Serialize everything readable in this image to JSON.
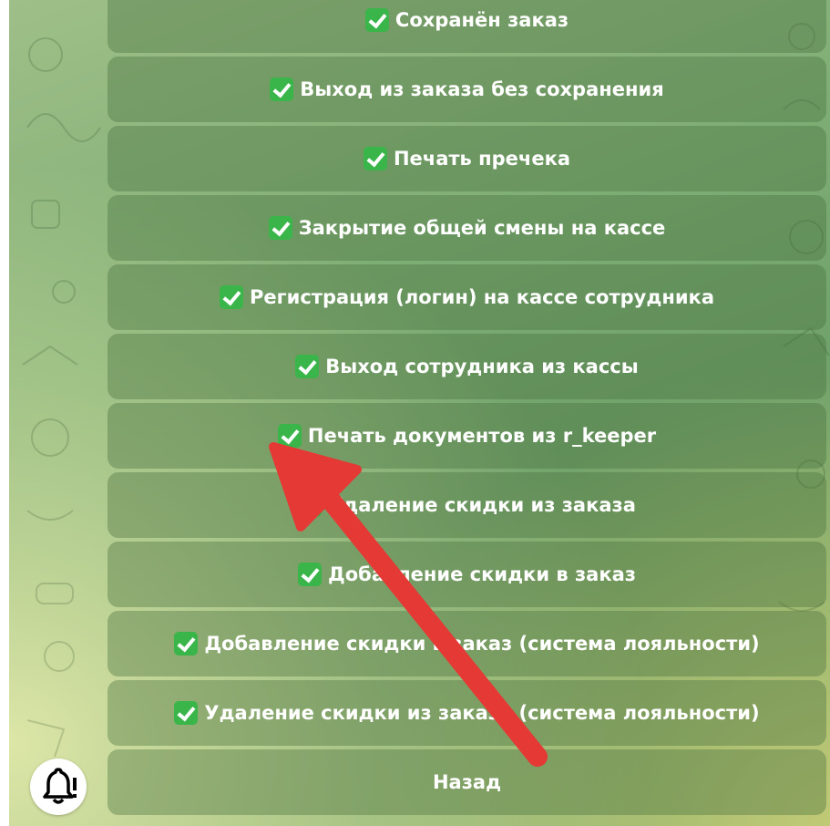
{
  "keyboard": {
    "buttons": [
      {
        "label": "Сохранён заказ",
        "checked": true
      },
      {
        "label": "Выход из заказа без сохранения",
        "checked": true
      },
      {
        "label": "Печать пречека",
        "checked": true
      },
      {
        "label": "Закрытие общей смены на кассе",
        "checked": true
      },
      {
        "label": "Регистрация (логин) на кассе сотрудника",
        "checked": true
      },
      {
        "label": "Выход сотрудника из кассы",
        "checked": true
      },
      {
        "label": "Печать документов из r_keeper",
        "checked": true
      },
      {
        "label": "Удаление скидки из заказа",
        "checked": true
      },
      {
        "label": "Добавление скидки в заказ",
        "checked": true
      },
      {
        "label": "Добавление скидки в заказ (система лояльности)",
        "checked": true
      },
      {
        "label": "Удаление скидки из заказа (система лояльности)",
        "checked": true
      },
      {
        "label": "Назад",
        "checked": false
      }
    ]
  },
  "icons": {
    "check": "check-mark-icon",
    "bell": "bell-alert-icon",
    "arrow": "red-annotation-arrow"
  },
  "colors": {
    "button_bg": "#466e3c",
    "check_green": "#3ab54a",
    "arrow_red": "#e53935"
  }
}
